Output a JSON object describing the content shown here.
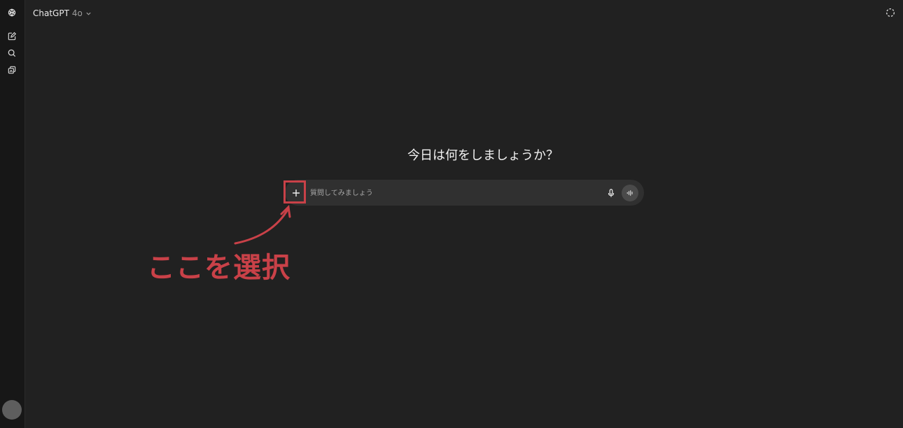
{
  "sidebar": {
    "items": [
      {
        "name": "new-chat",
        "icon": "compose-icon"
      },
      {
        "name": "search",
        "icon": "search-icon"
      },
      {
        "name": "library",
        "icon": "library-icon"
      }
    ],
    "logo_icon": "openai-logo-icon",
    "avatar_icon": "user-avatar"
  },
  "header": {
    "model_name": "ChatGPT",
    "model_version": "4o",
    "dropdown_icon": "chevron-down-icon",
    "top_right_icon": "temporary-chat-icon"
  },
  "main": {
    "heading": "今日は何をしましょうか？",
    "composer": {
      "placeholder": "質問してみましょう",
      "value": "",
      "plus_icon": "plus-icon",
      "mic_icon": "microphone-icon",
      "voice_icon": "voice-mode-icon"
    }
  },
  "annotation": {
    "label": "ここを選択",
    "color": "#c94148"
  },
  "colors": {
    "background": "#212121",
    "sidebar": "#171717",
    "composer": "#303030",
    "accent_annotation": "#c94148"
  }
}
